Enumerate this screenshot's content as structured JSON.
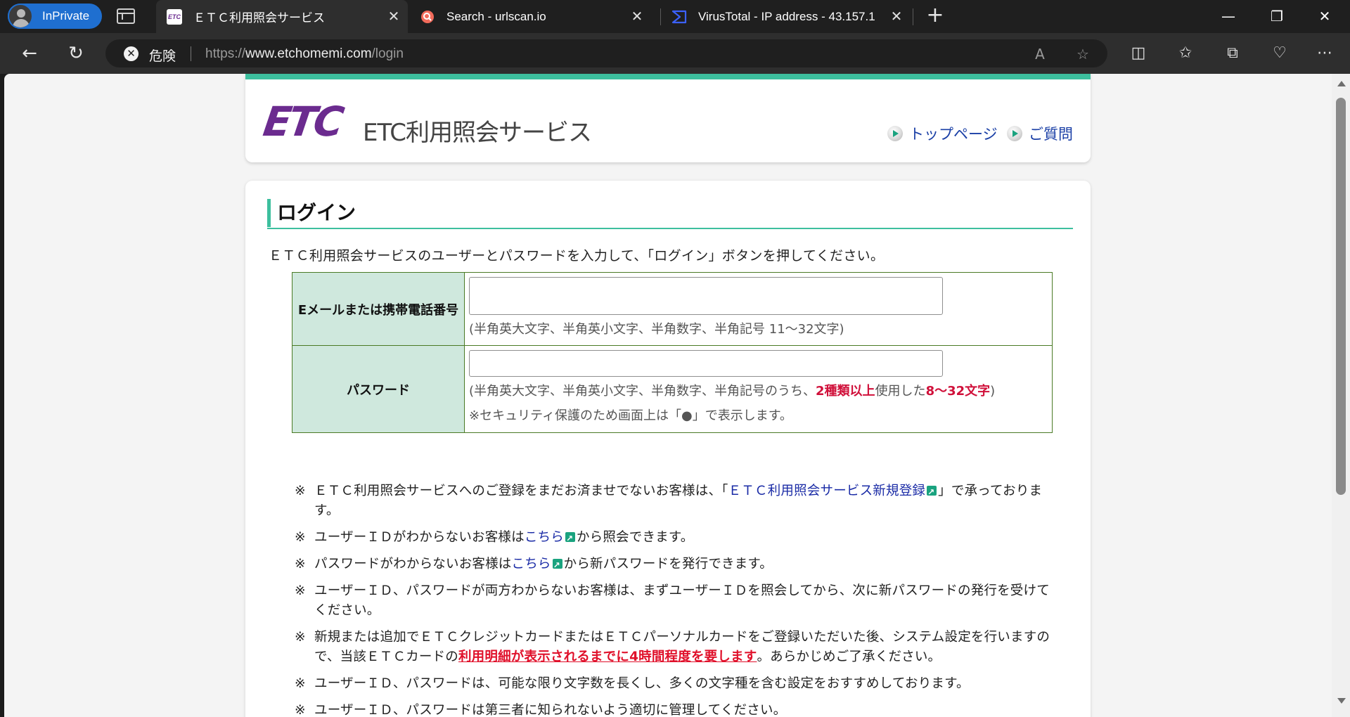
{
  "browser": {
    "profile_label": "InPrivate",
    "tabs": [
      {
        "title": "ＥＴＣ利用照会サービス",
        "favicon": "ETC"
      },
      {
        "title": "Search - urlscan.io",
        "favicon": "urlscan"
      },
      {
        "title": "VirusTotal - IP address - 43.157.1",
        "favicon": "virustotal"
      }
    ],
    "security_label": "危険",
    "url_scheme": "https://",
    "url_host": "www.etchomemi.com",
    "url_path": "/login"
  },
  "header": {
    "logo_mark": "ETC",
    "logo_text": "ETC利用照会サービス",
    "links": [
      "トップページ",
      "ご質問"
    ]
  },
  "login": {
    "heading": "ログイン",
    "intro": "ＥＴＣ利用照会サービスのユーザーとパスワードを入力して、「ログイン」ボタンを押してください。",
    "email_label": "Eメールまたは携帯電話番号",
    "email_value": "",
    "email_hint": "(半角英大文字、半角英小文字、半角数字、半角記号 11～32文字)",
    "password_label": "パスワード",
    "password_value": "",
    "password_hint_pre": "(半角英大文字、半角英小文字、半角数字、半角記号のうち、",
    "password_hint_em1": "2種類以上",
    "password_hint_mid": "使用した",
    "password_hint_em2": "8～32文字",
    "password_hint_post": ")",
    "password_hint2": "※セキュリティ保護のため画面上は「●」で表示します。"
  },
  "notes": {
    "mark": "※",
    "n1_pre": "ＥＴＣ利用照会サービスへのご登録をまだお済ませでないお客様は、「",
    "n1_link": "ＥＴＣ利用照会サービス新規登録",
    "n1_post": "」で承っております。",
    "n2_pre": "ユーザーＩＤがわからないお客様は",
    "n2_link": "こちら",
    "n2_post": "から照会できます。",
    "n3_pre": "パスワードがわからないお客様は",
    "n3_link": "こちら",
    "n3_post": "から新パスワードを発行できます。",
    "n4": "ユーザーＩＤ、パスワードが両方わからないお客様は、まずユーザーＩＤを照会してから、次に新パスワードの発行を受けてください。",
    "n5_pre": "新規または追加でＥＴＣクレジットカードまたはＥＴＣパーソナルカードをご登録いただいた後、システム設定を行いますので、当該ＥＴＣカードの",
    "n5_warn": "利用明細が表示されるまでに4時間程度を要します",
    "n5_post": "。あらかじめご了承ください。",
    "n6": "ユーザーＩＤ、パスワードは、可能な限り文字数を長くし、多くの文字種を含む設定をおすすめしております。",
    "n7": "ユーザーＩＤ、パスワードは第三者に知られないよう適切に管理してください。"
  },
  "colors": {
    "accent": "#3dbf9e",
    "logo": "#6b2b8f",
    "link": "#1a2ba6",
    "warning": "#e0102a",
    "table_header": "#cfe8dd"
  }
}
